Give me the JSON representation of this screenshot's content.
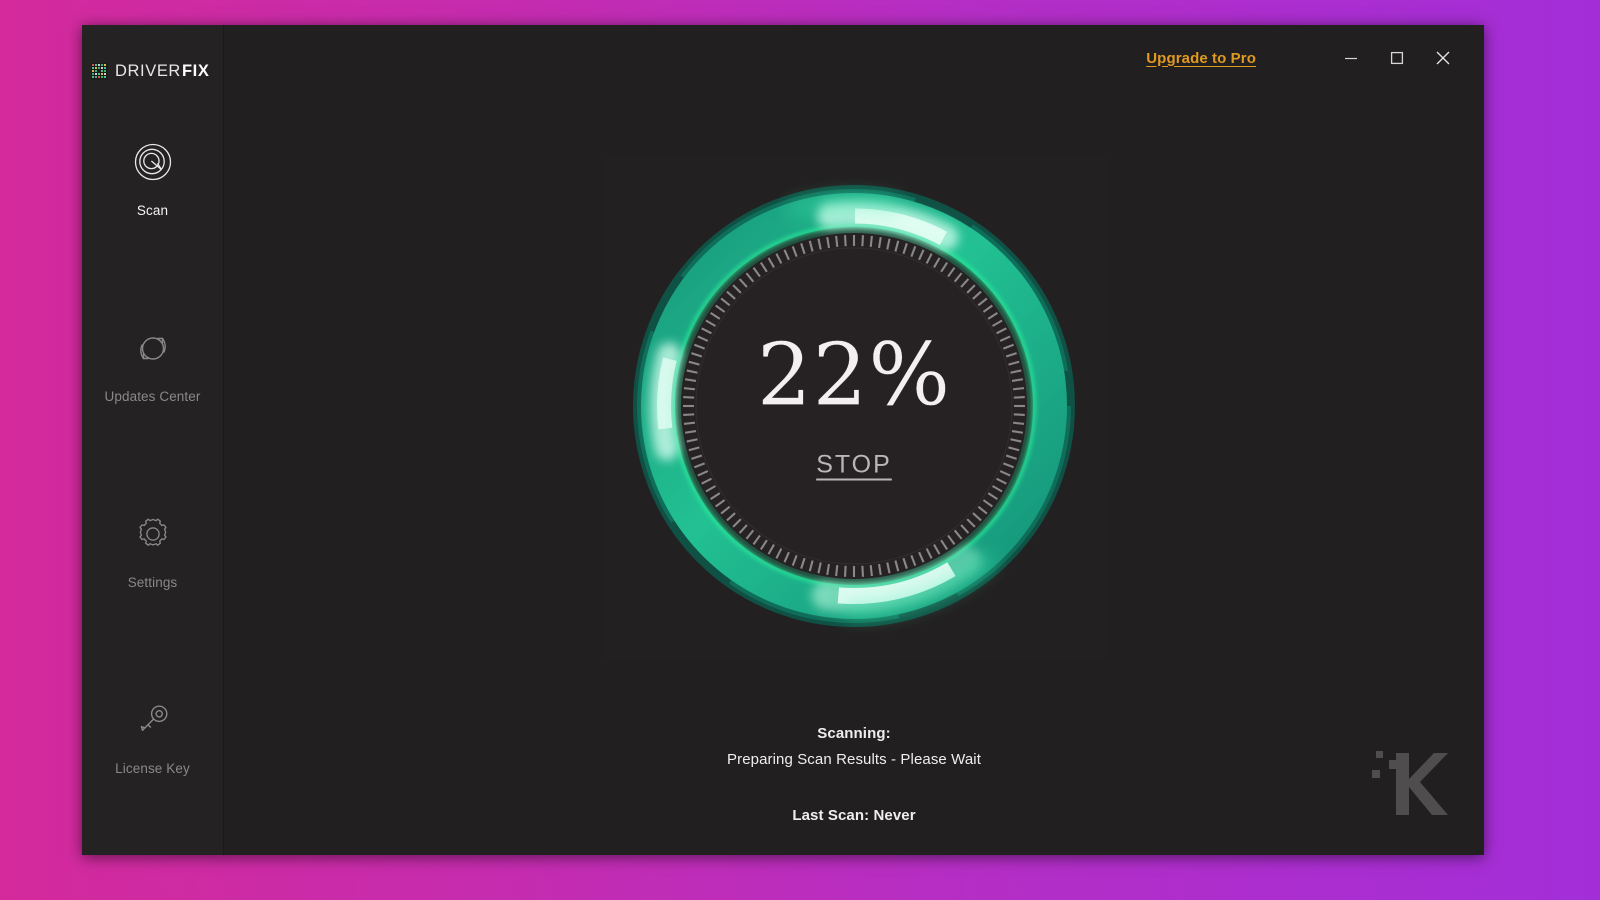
{
  "theme": {
    "page_gradient_from": "#d42a9c",
    "page_gradient_to": "#a32ed8",
    "window_bg": "#211f20",
    "sidebar_bg": "#242223",
    "accent_link": "#e09a22",
    "ring_teal": "#1f9e7e",
    "ring_glow": "#8ff2cd",
    "ring_bright": "#2fe08f",
    "text_primary": "#f2f0f0",
    "text_muted": "#8b8889"
  },
  "brand": {
    "name_light": "DRIVER",
    "name_bold": "FIX",
    "logo_icon": "pixel-grid-icon"
  },
  "titlebar": {
    "upgrade_label": "Upgrade to Pro",
    "minimize_icon": "minimize-icon",
    "maximize_icon": "maximize-icon",
    "close_icon": "close-icon"
  },
  "sidebar": {
    "items": [
      {
        "label": "Scan",
        "icon": "scan-radar-icon",
        "active": true
      },
      {
        "label": "Updates Center",
        "icon": "refresh-sync-icon",
        "active": false
      },
      {
        "label": "Settings",
        "icon": "gear-icon",
        "active": false
      },
      {
        "label": "License Key",
        "icon": "key-icon",
        "active": false
      }
    ]
  },
  "scan": {
    "percent_value": 22,
    "percent_label": "22%",
    "stop_label": "STOP",
    "scanning_label": "Scanning:",
    "scanning_detail": "Preparing Scan Results - Please Wait",
    "last_scan": "Last Scan: Never"
  },
  "watermark": {
    "name": "knowtechie-k-logo"
  }
}
